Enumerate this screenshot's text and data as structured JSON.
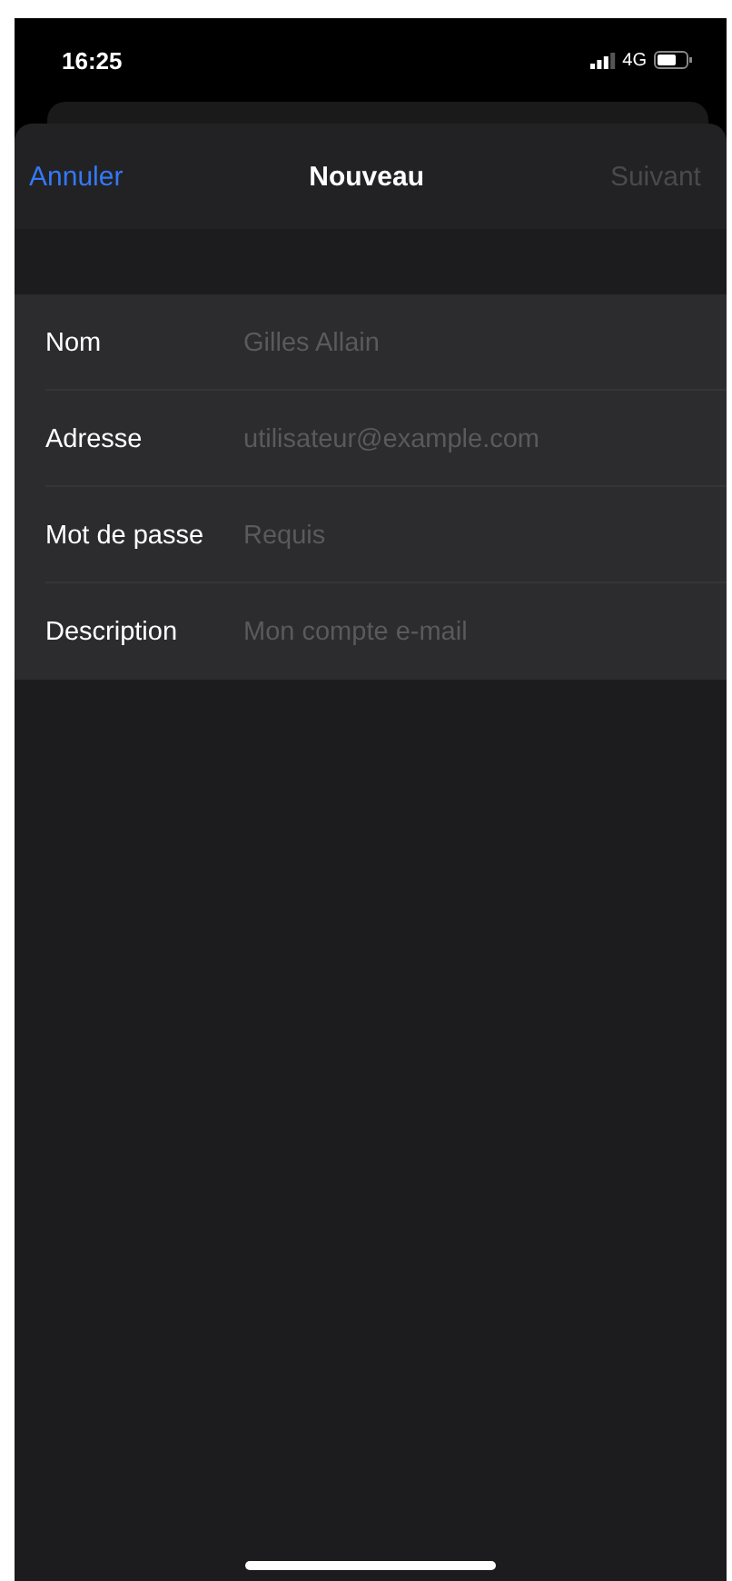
{
  "status_bar": {
    "time": "16:25",
    "network": "4G"
  },
  "nav": {
    "cancel": "Annuler",
    "title": "Nouveau",
    "next": "Suivant",
    "next_disabled": true
  },
  "fields": [
    {
      "label": "Nom",
      "placeholder": "Gilles Allain"
    },
    {
      "label": "Adresse",
      "placeholder": "utilisateur@example.com"
    },
    {
      "label": "Mot de passe",
      "placeholder": "Requis"
    },
    {
      "label": "Description",
      "placeholder": "Mon compte e-mail"
    }
  ]
}
